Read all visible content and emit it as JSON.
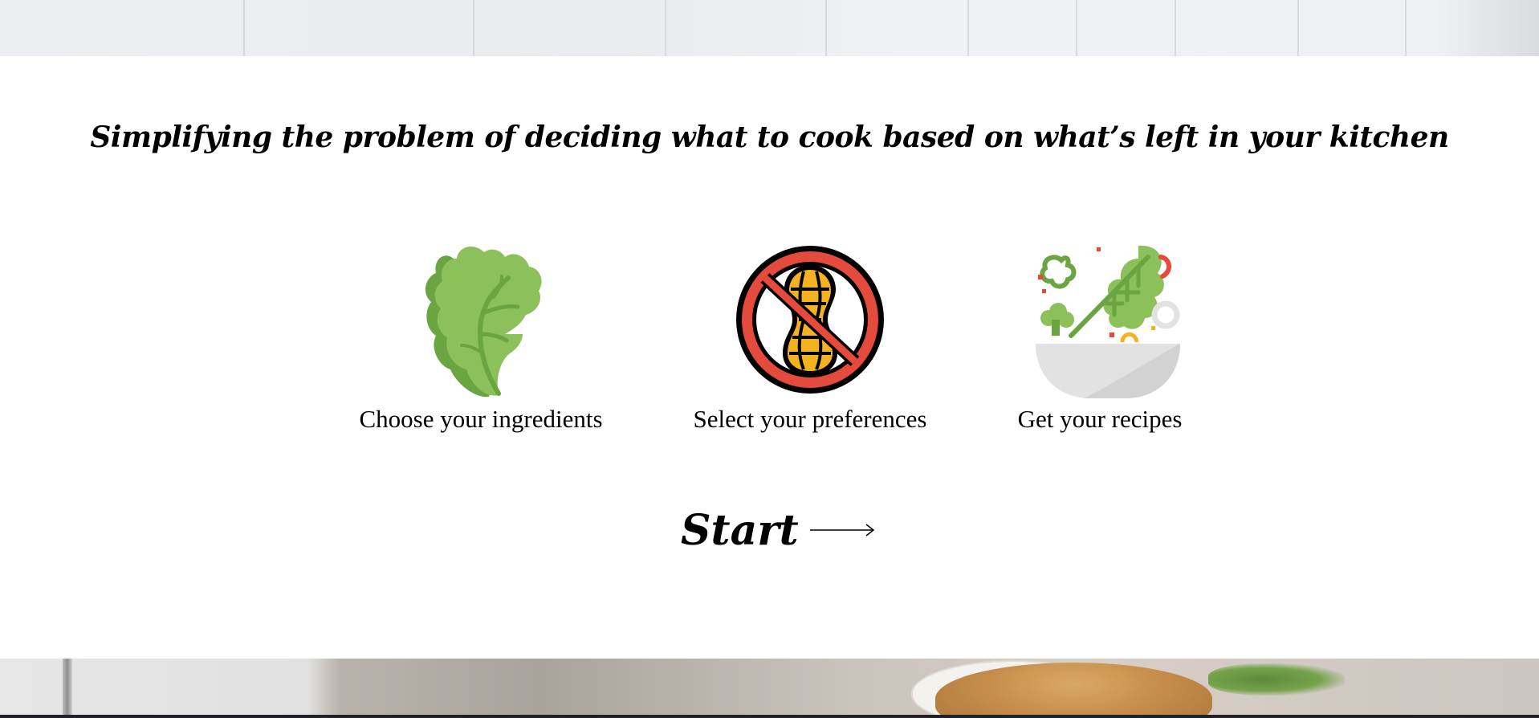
{
  "headline": "Simplifying the problem of deciding what to cook based on what’s left in your kitchen",
  "features": [
    {
      "icon": "lettuce-icon",
      "label": "Choose your ingredients"
    },
    {
      "icon": "no-peanut-icon",
      "label": "Select your preferences"
    },
    {
      "icon": "salad-bowl-icon",
      "label": "Get your recipes"
    }
  ],
  "cta": {
    "label": "Start",
    "icon": "arrow-right-icon"
  },
  "colors": {
    "text": "#000000",
    "background": "#ffffff",
    "lettuce_light": "#8BC05A",
    "lettuce_dark": "#6BA542",
    "prohibit_red": "#E54B3C",
    "peanut_yellow": "#F4B223",
    "bowl_gray": "#E2E2E2"
  }
}
